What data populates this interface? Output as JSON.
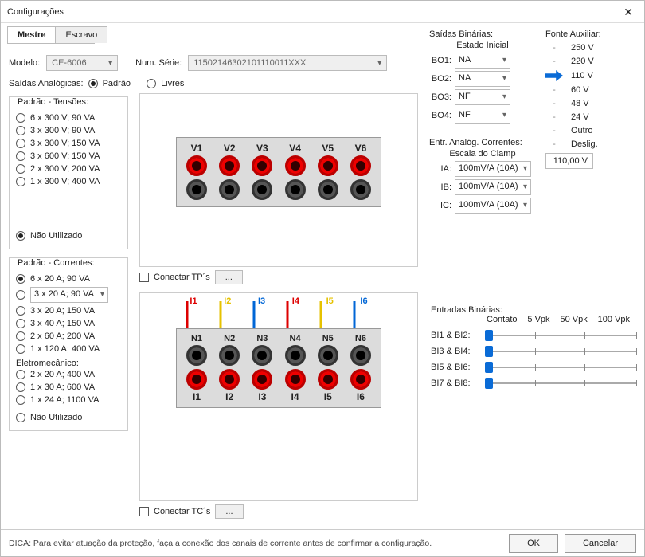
{
  "window_title": "Configurações",
  "tabs": {
    "mestre": "Mestre",
    "escravo": "Escravo"
  },
  "model_label": "Modelo:",
  "model_value": "CE-6006",
  "serial_label": "Num. Série:",
  "serial_value": "11502146302101110011XXX",
  "saidas_analog_label": "Saídas Analógicas:",
  "sa_radio_padrao": "Padrão",
  "sa_radio_livres": "Livres",
  "padrao_tensoes_title": "Padrão - Tensões:",
  "tensoes_opts": [
    "6 x 300 V; 90 VA",
    "3 x 300 V; 90 VA",
    "3 x 300 V; 150 VA",
    "3 x 600 V; 150 VA",
    "2 x 300 V; 200 VA",
    "1 x 300 V; 400 VA"
  ],
  "nao_utilizado": "Não Utilizado",
  "padrao_correntes_title": "Padrão - Correntes:",
  "correntes_opts": [
    "6 x 20 A; 90 VA",
    "3 x 20 A; 90 VA",
    "3 x 20 A; 150 VA",
    "3 x 40 A; 150 VA",
    "2 x 60 A; 200 VA",
    "1 x 120 A; 400 VA"
  ],
  "eletromecanico_title": "Eletromecânico:",
  "eletromecanico_opts": [
    "2 x 20 A; 400 VA",
    "1 x 30 A; 600 VA",
    "1 x 24 A; 1100 VA"
  ],
  "v_labels": [
    "V1",
    "V2",
    "V3",
    "V4",
    "V5",
    "V6"
  ],
  "n_labels": [
    "N1",
    "N2",
    "N3",
    "N4",
    "N5",
    "N6"
  ],
  "i_labels": [
    "I1",
    "I2",
    "I3",
    "I4",
    "I5",
    "I6"
  ],
  "conectar_tp": "Conectar TP´s",
  "conectar_tc": "Conectar TC´s",
  "saidas_bin_title": "Saídas Binárias:",
  "estado_inicial": "Estado Inicial",
  "bo1_l": "BO1:",
  "bo1_v": "NA",
  "bo2_l": "BO2:",
  "bo2_v": "NA",
  "bo3_l": "BO3:",
  "bo3_v": "NF",
  "bo4_l": "BO4:",
  "bo4_v": "NF",
  "fonte_aux_title": "Fonte Auxiliar:",
  "aux_values": [
    "250 V",
    "220 V",
    "110 V",
    "60 V",
    "48 V",
    "24 V",
    "Outro",
    "Deslig."
  ],
  "aux_selected_index": 2,
  "aux_input": "110,00 V",
  "eac_title": "Entr. Analóg. Correntes:",
  "escala_clamp": "Escala do Clamp",
  "ia_l": "IA:",
  "ia_v": "100mV/A (10A)",
  "ib_l": "IB:",
  "ib_v": "100mV/A (10A)",
  "ic_l": "IC:",
  "ic_v": "100mV/A (10A)",
  "eb_title": "Entradas Binárias:",
  "eb_cols": [
    "Contato",
    "5 Vpk",
    "50 Vpk",
    "100 Vpk"
  ],
  "eb_rows": [
    "BI1 & BI2:",
    "BI3 & BI4:",
    "BI5 & BI6:",
    "BI7 & BI8:"
  ],
  "hint": "DICA: Para evitar atuação da proteção, faça a conexão dos canais de corrente antes de confirmar a configuração.",
  "ok": "OK",
  "cancel": "Cancelar",
  "dots": "..."
}
